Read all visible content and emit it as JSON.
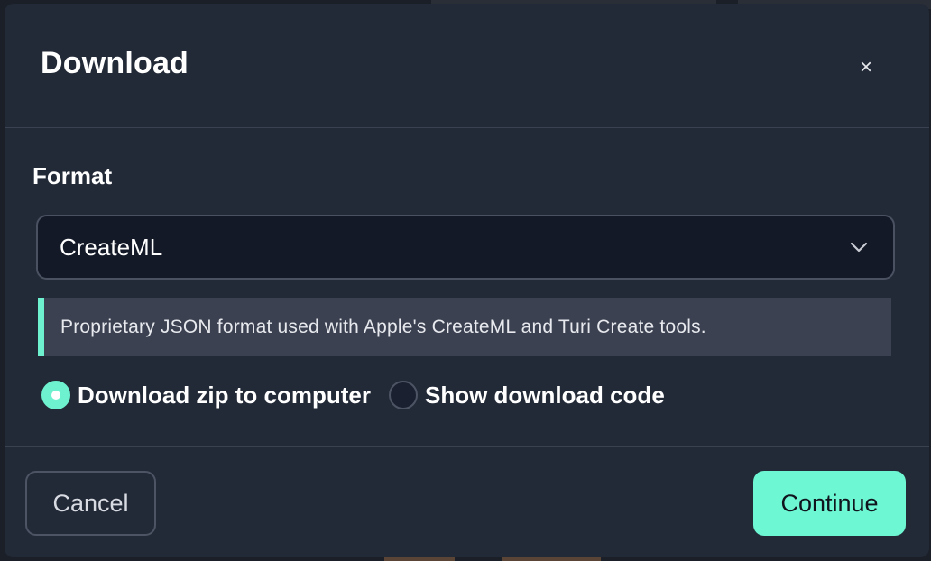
{
  "dialog": {
    "title": "Download",
    "close_glyph": "×"
  },
  "format": {
    "label": "Format",
    "selected": "CreateML",
    "description": "Proprietary JSON format used with Apple's CreateML and Turi Create tools."
  },
  "download_options": [
    {
      "label": "Download zip to computer",
      "checked": true
    },
    {
      "label": "Show download code",
      "checked": false
    }
  ],
  "footer": {
    "cancel_label": "Cancel",
    "continue_label": "Continue"
  },
  "colors": {
    "modal_bg": "#232a37",
    "accent": "#6ef7d3",
    "select_bg": "#131927",
    "info_bg": "#3b4150"
  },
  "icons": {
    "close": "close-icon",
    "chevron": "chevron-down-icon"
  }
}
